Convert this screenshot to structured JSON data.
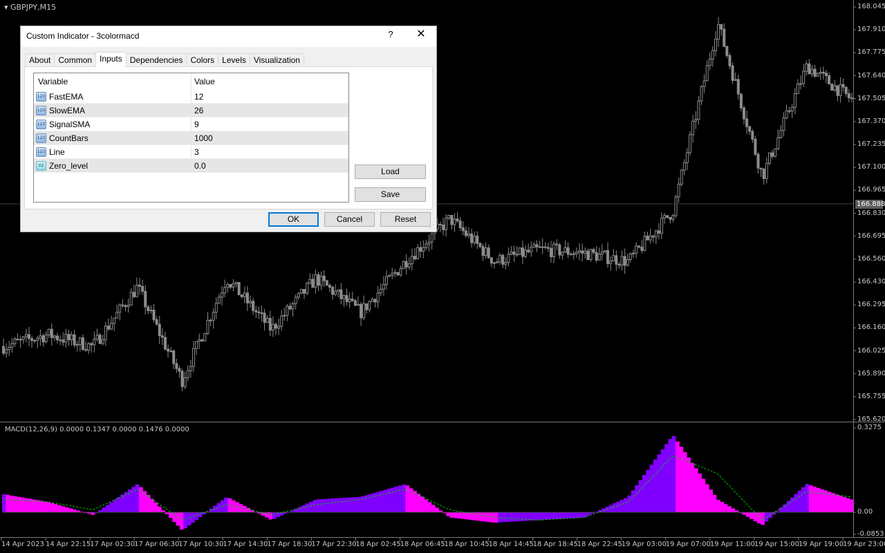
{
  "chart": {
    "symbol": "GBPJPY,M15",
    "price_ticks": [
      "168.045",
      "167.910",
      "167.775",
      "167.640",
      "167.505",
      "167.370",
      "167.235",
      "167.100",
      "166.965",
      "166.830",
      "166.695",
      "166.560",
      "166.430",
      "166.295",
      "166.160",
      "166.025",
      "165.890",
      "165.755",
      "165.620"
    ],
    "current_price": "166.888",
    "time_ticks": [
      "14 Apr 2023",
      "14 Apr 22:15",
      "17 Apr 02:30",
      "17 Apr 06:30",
      "17 Apr 10:30",
      "17 Apr 14:30",
      "17 Apr 18:30",
      "17 Apr 22:30",
      "18 Apr 02:45",
      "18 Apr 06:45",
      "18 Apr 10:45",
      "18 Apr 14:45",
      "18 Apr 18:45",
      "18 Apr 22:45",
      "19 Apr 03:00",
      "19 Apr 07:00",
      "19 Apr 11:00",
      "19 Apr 15:00",
      "19 Apr 19:00",
      "19 Apr 23:00"
    ],
    "indicator_label": "MACD(12,26,9) 0.0000 0.1347 0.0000 0.1476 0.0000",
    "indicator_ticks": [
      "0.3275",
      "0.00",
      "-0.0853"
    ],
    "colors": {
      "background": "#000000",
      "candle": "#8c8c8c",
      "grid_line": "#3c3c3c",
      "macd_up": "#ff00ff",
      "macd_down": "#8000ff",
      "signal": "#00c000"
    }
  },
  "chart_data": {
    "type": "line",
    "title": "GBPJPY,M15",
    "xlabel": "",
    "ylabel": "",
    "ylim": [
      165.62,
      168.045
    ],
    "x": [
      "14 Apr 2023",
      "14 Apr 22:15",
      "17 Apr 02:30",
      "17 Apr 06:30",
      "17 Apr 10:30",
      "17 Apr 14:30",
      "17 Apr 18:30",
      "17 Apr 22:30",
      "18 Apr 02:45",
      "18 Apr 06:45",
      "18 Apr 10:45",
      "18 Apr 14:45",
      "18 Apr 18:45",
      "18 Apr 22:45",
      "19 Apr 03:00",
      "19 Apr 07:00",
      "19 Apr 11:00",
      "19 Apr 15:00",
      "19 Apr 19:00",
      "19 Apr 23:00"
    ],
    "series": [
      {
        "values": [
          166.05,
          166.12,
          166.05,
          166.4,
          165.85,
          166.45,
          166.15,
          166.45,
          166.25,
          166.55,
          166.8,
          166.55,
          166.62,
          166.6,
          166.55,
          166.85,
          167.95,
          167.05,
          167.7,
          167.5
        ]
      }
    ],
    "macd": {
      "ylim": [
        -0.0853,
        0.3275
      ],
      "x": [
        "14 Apr 2023",
        "14 Apr 22:15",
        "17 Apr 02:30",
        "17 Apr 06:30",
        "17 Apr 10:30",
        "17 Apr 14:30",
        "17 Apr 18:30",
        "17 Apr 22:30",
        "18 Apr 02:45",
        "18 Apr 06:45",
        "18 Apr 10:45",
        "18 Apr 14:45",
        "18 Apr 18:45",
        "18 Apr 22:45",
        "19 Apr 03:00",
        "19 Apr 07:00",
        "19 Apr 11:00",
        "19 Apr 15:00",
        "19 Apr 19:00",
        "19 Apr 23:00"
      ],
      "histogram": [
        0.07,
        0.04,
        -0.01,
        0.11,
        -0.07,
        0.06,
        -0.03,
        0.05,
        0.06,
        0.11,
        -0.02,
        -0.04,
        -0.03,
        -0.02,
        0.06,
        0.3,
        0.05,
        -0.05,
        0.11,
        0.05
      ],
      "signal": [
        0.05,
        0.04,
        0.01,
        0.09,
        -0.03,
        0.03,
        -0.01,
        0.03,
        0.05,
        0.09,
        0.01,
        -0.02,
        -0.03,
        -0.02,
        0.04,
        0.22,
        0.15,
        -0.03,
        0.08,
        0.06
      ]
    }
  },
  "dialog": {
    "title": "Custom Indicator - 3colormacd",
    "help_glyph": "?",
    "close_glyph": "✕",
    "tabs": [
      "About",
      "Common",
      "Inputs",
      "Dependencies",
      "Colors",
      "Levels",
      "Visualization"
    ],
    "active_tab": "Inputs",
    "grid": {
      "col_variable": "Variable",
      "col_value": "Value",
      "rows": [
        {
          "name": "FastEMA",
          "value": "12",
          "icon": "123"
        },
        {
          "name": "SlowEMA",
          "value": "26",
          "icon": "123"
        },
        {
          "name": "SignalSMA",
          "value": "9",
          "icon": "123"
        },
        {
          "name": "CountBars",
          "value": "1000",
          "icon": "123"
        },
        {
          "name": "Line",
          "value": "3",
          "icon": "123"
        },
        {
          "name": "Zero_level",
          "value": "0.0",
          "icon": "V2"
        }
      ]
    },
    "buttons": {
      "load": "Load",
      "save": "Save",
      "ok": "OK",
      "cancel": "Cancel",
      "reset": "Reset"
    }
  }
}
